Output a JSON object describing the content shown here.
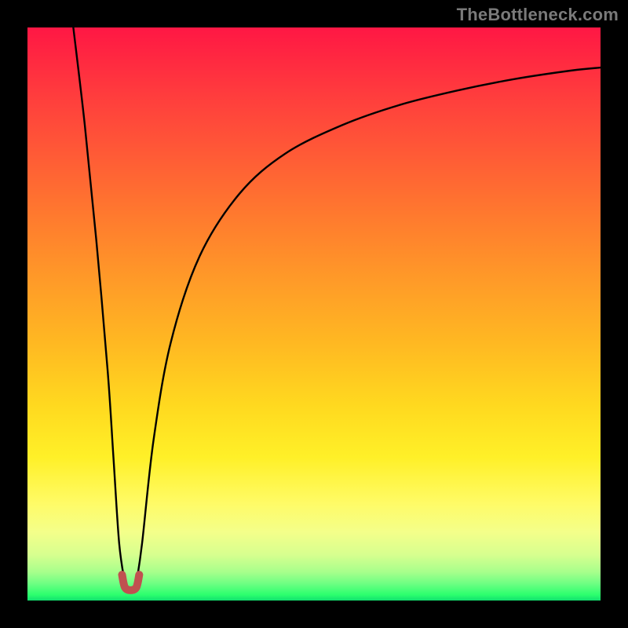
{
  "watermark": "TheBottleneck.com",
  "colors": {
    "background": "#000000",
    "gradient_top": "#ff1744",
    "gradient_mid": "#ffd91f",
    "gradient_bottom": "#11e06e",
    "curve_stroke": "#000000",
    "min_marker": "#c05050"
  },
  "chart_data": {
    "type": "line",
    "title": "",
    "xlabel": "",
    "ylabel": "",
    "xlim": [
      0,
      100
    ],
    "ylim": [
      0,
      100
    ],
    "grid": false,
    "legend": false,
    "annotations": [
      "Background gradient: red (high bottleneck %) at top to green (optimal) at bottom"
    ],
    "series": [
      {
        "name": "bottleneck_curve_left",
        "description": "Steep descending approach to minimum from left edge",
        "x": [
          8,
          10,
          12,
          14,
          15,
          16,
          17
        ],
        "values": [
          100,
          83,
          63,
          40,
          25,
          10,
          3
        ]
      },
      {
        "name": "bottleneck_curve_right",
        "description": "Rising asymptotic curve from minimum toward right edge",
        "x": [
          19,
          20,
          22,
          25,
          30,
          37,
          45,
          55,
          65,
          75,
          85,
          95,
          100
        ],
        "values": [
          3,
          10,
          28,
          45,
          60,
          71,
          78,
          83,
          86.5,
          89,
          91,
          92.5,
          93
        ]
      },
      {
        "name": "optimal_minimum_marker",
        "description": "Small U-shaped marker at curve minimum (optimal balance point)",
        "x": [
          16.5,
          17,
          18,
          19,
          19.5
        ],
        "values": [
          4.5,
          2.3,
          1.8,
          2.3,
          4.5
        ]
      }
    ]
  }
}
